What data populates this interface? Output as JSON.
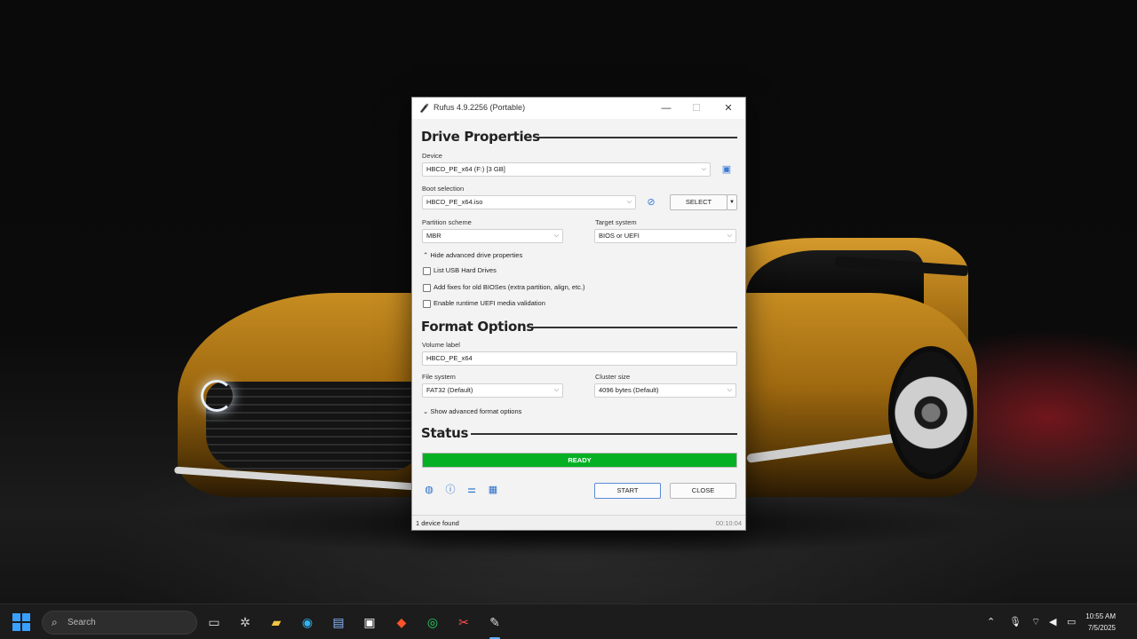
{
  "window": {
    "title": "Rufus 4.9.2256 (Portable)",
    "controls": {
      "minimize": "—",
      "maximize": "☐",
      "close": "✕"
    }
  },
  "drive_properties": {
    "heading": "Drive Properties",
    "device_label": "Device",
    "device_value": "HBCD_PE_x64 (F:) [3 GB]",
    "boot_selection_label": "Boot selection",
    "boot_selection_value": "HBCD_PE_x64.iso",
    "select_button": "SELECT",
    "partition_scheme_label": "Partition scheme",
    "partition_scheme_value": "MBR",
    "target_system_label": "Target system",
    "target_system_value": "BIOS or UEFI",
    "advanced_toggle": "Hide advanced drive properties",
    "checkboxes": [
      {
        "label": "List USB Hard Drives",
        "checked": false
      },
      {
        "label": "Add fixes for old BIOSes (extra partition, align, etc.)",
        "checked": false
      },
      {
        "label": "Enable runtime UEFI media validation",
        "checked": false
      }
    ]
  },
  "format_options": {
    "heading": "Format Options",
    "volume_label_label": "Volume label",
    "volume_label_value": "HBCD_PE_x64",
    "file_system_label": "File system",
    "file_system_value": "FAT32 (Default)",
    "cluster_size_label": "Cluster size",
    "cluster_size_value": "4096 bytes (Default)",
    "advanced_toggle": "Show advanced format options"
  },
  "status": {
    "heading": "Status",
    "progress_text": "READY",
    "progress_fraction": 1.0,
    "progress_color": "#06b025",
    "start_button": "START",
    "close_button": "CLOSE",
    "statusbar_left": "1 device found",
    "statusbar_right": "00:10:04"
  },
  "taskbar": {
    "search_placeholder": "Search",
    "clock_time": "10:55 AM",
    "clock_date": "7/5/2025",
    "accent": "#60b0ff"
  }
}
